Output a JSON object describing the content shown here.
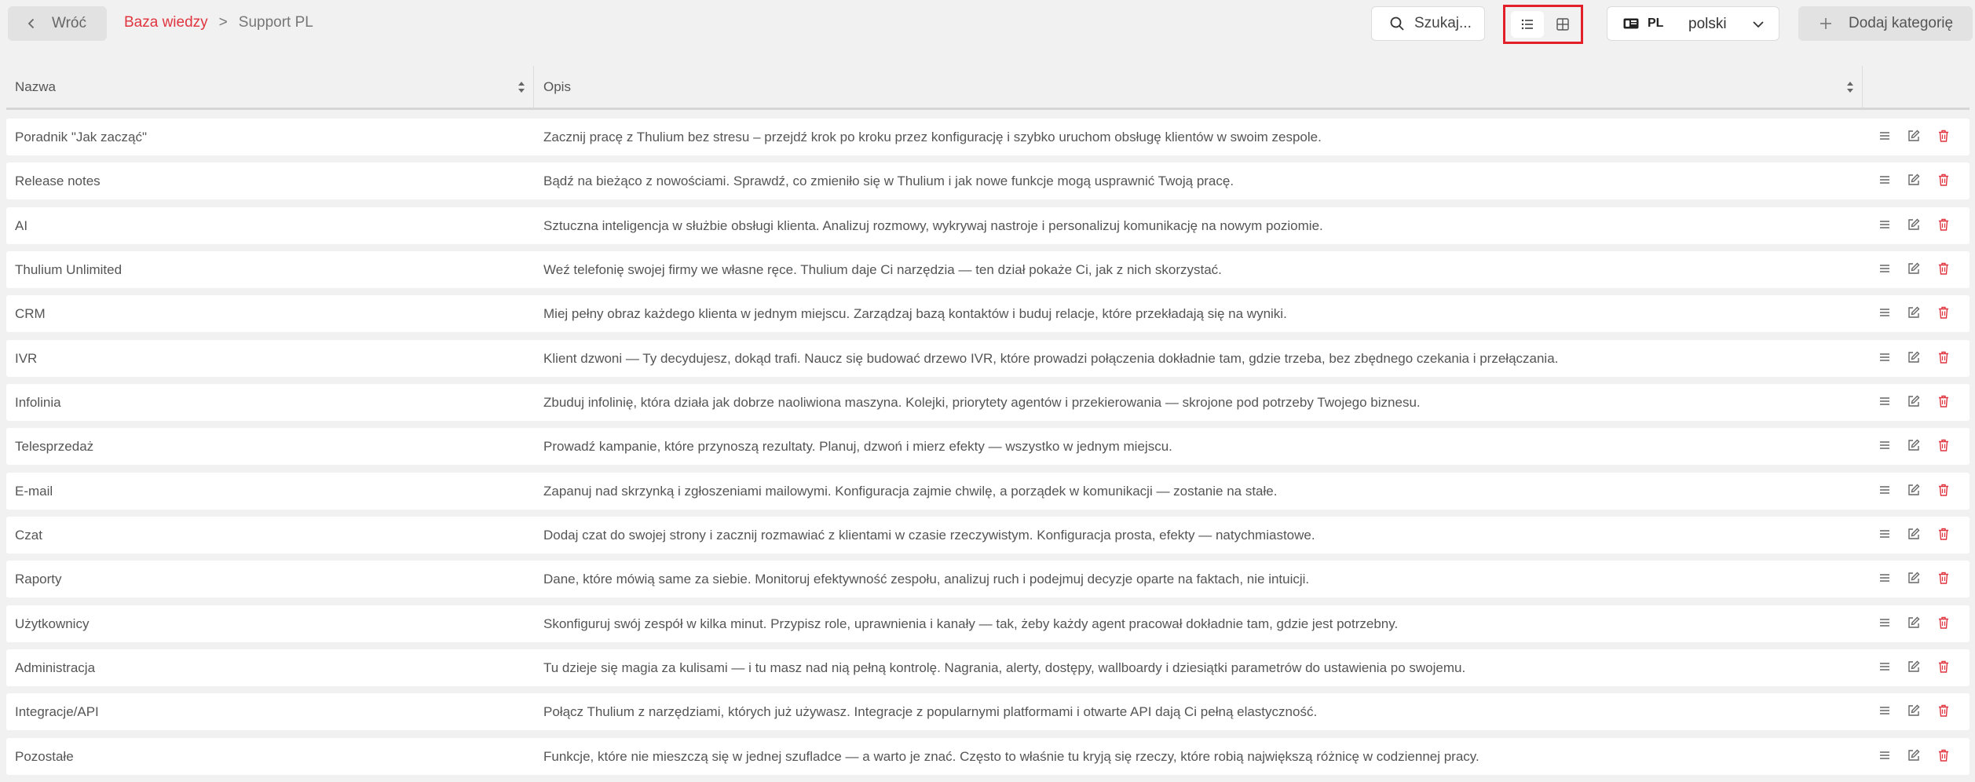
{
  "toolbar": {
    "back_label": "Wróć",
    "search_label": "Szukaj...",
    "add_label": "Dodaj kategorię"
  },
  "breadcrumb": {
    "root": "Baza wiedzy",
    "separator": ">",
    "current": "Support PL"
  },
  "language": {
    "code": "PL",
    "name": "polski"
  },
  "table": {
    "columns": [
      "Nazwa",
      "Opis"
    ],
    "rows": [
      {
        "name": "Poradnik \"Jak zacząć\"",
        "desc": "Zacznij pracę z Thulium bez stresu – przejdź krok po kroku przez konfigurację i szybko uruchom obsługę klientów w swoim zespole."
      },
      {
        "name": "Release notes",
        "desc": "Bądź na bieżąco z nowościami. Sprawdź, co zmieniło się w Thulium i jak nowe funkcje mogą usprawnić Twoją pracę."
      },
      {
        "name": "AI",
        "desc": "Sztuczna inteligencja w służbie obsługi klienta. Analizuj rozmowy, wykrywaj nastroje i personalizuj komunikację na nowym poziomie."
      },
      {
        "name": "Thulium Unlimited",
        "desc": "Weź telefonię swojej firmy we własne ręce. Thulium daje Ci narzędzia — ten dział pokaże Ci, jak z nich skorzystać."
      },
      {
        "name": "CRM",
        "desc": "Miej pełny obraz każdego klienta w jednym miejscu. Zarządzaj bazą kontaktów i buduj relacje, które przekładają się na wyniki."
      },
      {
        "name": "IVR",
        "desc": "Klient dzwoni — Ty decydujesz, dokąd trafi. Naucz się budować drzewo IVR, które prowadzi połączenia dokładnie tam, gdzie trzeba, bez zbędnego czekania i przełączania."
      },
      {
        "name": "Infolinia",
        "desc": "Zbuduj infolinię, która działa jak dobrze naoliwiona maszyna. Kolejki, priorytety agentów i przekierowania — skrojone pod potrzeby Twojego biznesu."
      },
      {
        "name": "Telesprzedaż",
        "desc": "Prowadź kampanie, które przynoszą rezultaty. Planuj, dzwoń i mierz efekty — wszystko w jednym miejscu."
      },
      {
        "name": "E-mail",
        "desc": "Zapanuj nad skrzynką i zgłoszeniami mailowymi. Konfiguracja zajmie chwilę, a porządek w komunikacji — zostanie na stałe."
      },
      {
        "name": "Czat",
        "desc": "Dodaj czat do swojej strony i zacznij rozmawiać z klientami w czasie rzeczywistym. Konfiguracja prosta, efekty — natychmiastowe."
      },
      {
        "name": "Raporty",
        "desc": "Dane, które mówią same za siebie. Monitoruj efektywność zespołu, analizuj ruch i podejmuj decyzje oparte na faktach, nie intuicji."
      },
      {
        "name": "Użytkownicy",
        "desc": "Skonfiguruj swój zespół w kilka minut. Przypisz role, uprawnienia i kanały — tak, żeby każdy agent pracował dokładnie tam, gdzie jest potrzebny."
      },
      {
        "name": "Administracja",
        "desc": "Tu dzieje się magia za kulisami — i tu masz nad nią pełną kontrolę. Nagrania, alerty, dostępy, wallboardy i dziesiątki parametrów do ustawienia po swojemu."
      },
      {
        "name": "Integracje/API",
        "desc": "Połącz Thulium z narzędziami, których już używasz. Integracje z popularnymi platformami i otwarte API dają Ci pełną elastyczność."
      },
      {
        "name": "Pozostałe",
        "desc": "Funkcje, które nie mieszczą się w jednej szufladce — a warto je znać. Często to właśnie tu kryją się rzeczy, które robią największą różnicę w codziennej pracy."
      }
    ]
  },
  "colors": {
    "accent": "#e0343f",
    "highlight_border": "#e3202a",
    "delete_icon": "#e0343f"
  }
}
